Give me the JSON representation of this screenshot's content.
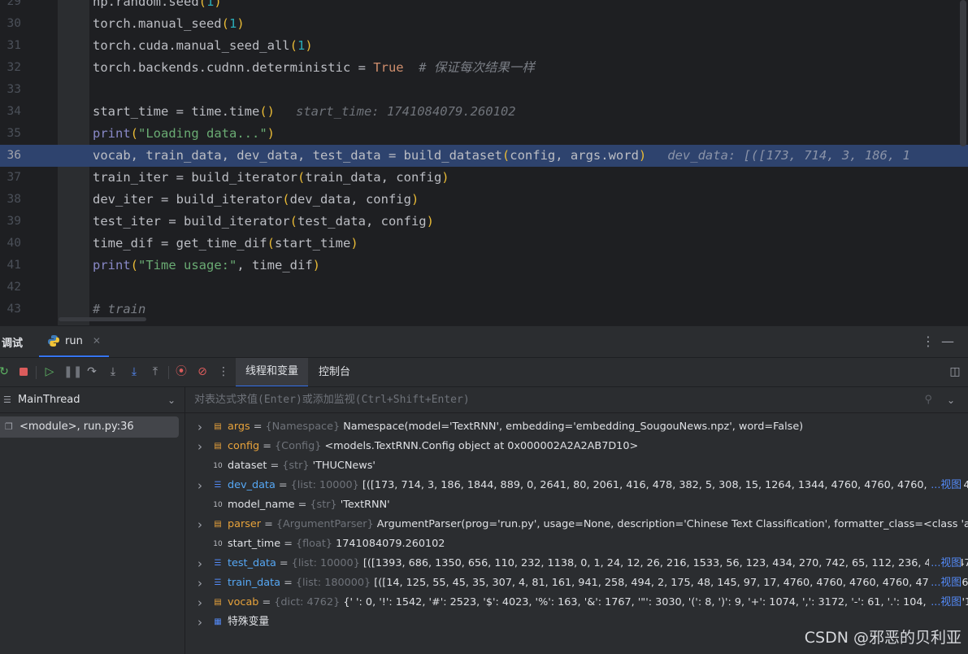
{
  "editor": {
    "lines": [
      {
        "n": "29",
        "parts": [
          [
            "plain",
            "np.random.seed"
          ],
          [
            "paren",
            "("
          ],
          [
            "num",
            "1"
          ],
          [
            "paren",
            ")"
          ]
        ]
      },
      {
        "n": "30",
        "parts": [
          [
            "plain",
            "torch.manual_seed"
          ],
          [
            "paren",
            "("
          ],
          [
            "num",
            "1"
          ],
          [
            "paren",
            ")"
          ]
        ]
      },
      {
        "n": "31",
        "parts": [
          [
            "plain",
            "torch.cuda.manual_seed_all"
          ],
          [
            "paren",
            "("
          ],
          [
            "num",
            "1"
          ],
          [
            "paren",
            ")"
          ]
        ]
      },
      {
        "n": "32",
        "parts": [
          [
            "plain",
            "torch.backends.cudnn.deterministic = "
          ],
          [
            "kw",
            "True"
          ],
          [
            "comment",
            "  # 保证每次结果一样"
          ]
        ]
      },
      {
        "n": "33",
        "parts": []
      },
      {
        "n": "34",
        "parts": [
          [
            "plain",
            "start_time = time.time"
          ],
          [
            "paren",
            "()"
          ],
          [
            "hint",
            "start_time: 1741084079.260102"
          ]
        ]
      },
      {
        "n": "35",
        "parts": [
          [
            "builtin",
            "print"
          ],
          [
            "paren",
            "("
          ],
          [
            "str",
            "\"Loading data...\""
          ],
          [
            "paren",
            ")"
          ]
        ]
      },
      {
        "n": "36",
        "current": true,
        "parts": [
          [
            "plain",
            "vocab, train_data, dev_data, test_data = build_dataset"
          ],
          [
            "paren",
            "("
          ],
          [
            "plain",
            "config, args.word"
          ],
          [
            "paren",
            ")"
          ],
          [
            "hint",
            "dev_data: [([173, 714, 3, 186, 1"
          ]
        ]
      },
      {
        "n": "37",
        "parts": [
          [
            "plain",
            "train_iter = build_iterator"
          ],
          [
            "paren",
            "("
          ],
          [
            "plain",
            "train_data, config"
          ],
          [
            "paren",
            ")"
          ]
        ]
      },
      {
        "n": "38",
        "parts": [
          [
            "plain",
            "dev_iter = build_iterator"
          ],
          [
            "paren",
            "("
          ],
          [
            "plain",
            "dev_data, config"
          ],
          [
            "paren",
            ")"
          ]
        ]
      },
      {
        "n": "39",
        "parts": [
          [
            "plain",
            "test_iter = build_iterator"
          ],
          [
            "paren",
            "("
          ],
          [
            "plain",
            "test_data, config"
          ],
          [
            "paren",
            ")"
          ]
        ]
      },
      {
        "n": "40",
        "parts": [
          [
            "plain",
            "time_dif = get_time_dif"
          ],
          [
            "paren",
            "("
          ],
          [
            "plain",
            "start_time"
          ],
          [
            "paren",
            ")"
          ]
        ]
      },
      {
        "n": "41",
        "parts": [
          [
            "builtin",
            "print"
          ],
          [
            "paren",
            "("
          ],
          [
            "str",
            "\"Time usage:\""
          ],
          [
            "plain",
            ", time_dif"
          ],
          [
            "paren",
            ")"
          ]
        ]
      },
      {
        "n": "42",
        "parts": []
      },
      {
        "n": "43",
        "parts": [
          [
            "comment",
            "# train"
          ]
        ]
      }
    ]
  },
  "debug": {
    "title": "调试",
    "run_tab": "run",
    "subtabs": {
      "threads": "线程和变量",
      "console": "控制台"
    },
    "thread_name": "MainThread",
    "frame": "<module>, run.py:36",
    "eval_placeholder": "对表达式求值(Enter)或添加监视(Ctrl+Shift+Enter)",
    "more_label": "...视图",
    "variables": [
      {
        "name": "args",
        "style": "orange",
        "icon": "object-icon",
        "expandable": true,
        "type": "{Namespace}",
        "value": "Namespace(model='TextRNN', embedding='embedding_SougouNews.npz', word=False)",
        "more": false
      },
      {
        "name": "config",
        "style": "orange",
        "icon": "object-icon",
        "expandable": true,
        "type": "{Config}",
        "value": "<models.TextRNN.Config object at 0x000002A2A2AB7D10>",
        "more": false
      },
      {
        "name": "dataset",
        "style": "plain",
        "icon": "primitive-icon",
        "expandable": false,
        "type": "{str}",
        "value": "'THUCNews'",
        "more": false
      },
      {
        "name": "dev_data",
        "style": "blue",
        "icon": "list-icon",
        "expandable": true,
        "type": "{list: 10000}",
        "value": "[([173, 714, 3, 186, 1844, 889, 0, 2641, 80, 2061, 416, 478, 382, 5, 308, 15, 1264, 1344, 4760, 4760, 4760, 4760, 47",
        "more": true
      },
      {
        "name": "model_name",
        "style": "plain",
        "icon": "primitive-icon",
        "expandable": false,
        "type": "{str}",
        "value": "'TextRNN'",
        "more": false
      },
      {
        "name": "parser",
        "style": "orange",
        "icon": "object-icon",
        "expandable": true,
        "type": "{ArgumentParser}",
        "value": "ArgumentParser(prog='run.py', usage=None, description='Chinese Text Classification', formatter_class=<class 'argparse",
        "more": false
      },
      {
        "name": "start_time",
        "style": "plain",
        "icon": "primitive-icon",
        "expandable": false,
        "type": "{float}",
        "value": "1741084079.260102",
        "more": false
      },
      {
        "name": "test_data",
        "style": "blue",
        "icon": "list-icon",
        "expandable": true,
        "type": "{list: 10000}",
        "value": "[([1393, 686, 1350, 656, 110, 232, 1138, 0, 1, 24, 12, 26, 216, 1533, 56, 123, 434, 270, 742, 65, 112, 236, 4760, 476",
        "more": true
      },
      {
        "name": "train_data",
        "style": "blue",
        "icon": "list-icon",
        "expandable": true,
        "type": "{list: 180000}",
        "value": "[([14, 125, 55, 45, 35, 307, 4, 81, 161, 941, 258, 494, 2, 175, 48, 145, 97, 17, 4760, 4760, 4760, 4760, 4760, 4760",
        "more": true
      },
      {
        "name": "vocab",
        "style": "orange",
        "icon": "object-icon",
        "expandable": true,
        "type": "{dict: 4762}",
        "value": "{' ': 0, '!': 1542, '#': 2523, '$': 4023, '%': 163, '&': 1767, '\"': 3030, '(': 8, ')': 9, '+': 1074, ',': 3172, '-': 61, '.': 104, '0': 1, '1': 2, '",
        "more": true
      },
      {
        "name": "特殊变量",
        "style": "plain",
        "icon": "special-vars-icon",
        "expandable": true,
        "type": "",
        "value": "",
        "more": false
      }
    ]
  },
  "watermark": "CSDN @邪恶的贝利亚"
}
